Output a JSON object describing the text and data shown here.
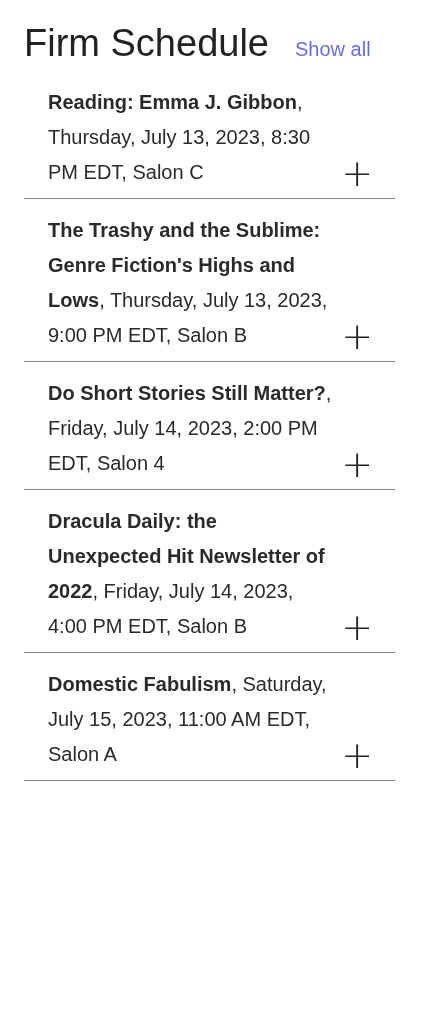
{
  "heading": "Firm Schedule",
  "show_all_link": "Show all",
  "events": [
    {
      "text": "**Reading: Emma J. Gibbon**, Thursday, July 13, 2023, 8:30 PM EDT, Salon C",
      "add_button": "+"
    },
    {
      "text": "**The Trashy and the Sublime: Genre Fiction's Highs and Lows**, Thursday, July 13, 2023, 9:00 PM EDT, Salon B",
      "add_button": "+"
    },
    {
      "text": "**Do Short Stories Still Matter?**, Friday, July 14, 2023, 2:00 PM EDT, Salon 4",
      "add_button": "+"
    },
    {
      "text": "**Dracula Daily: the Unexpected Hit Newsletter of 2022**, Friday, July 14, 2023, 4:00 PM EDT, Salon B",
      "add_button": "+"
    },
    {
      "text": "**Domestic Fabulism**, Saturday, July 15, 2023, 11:00 AM EDT, Salon A",
      "add_button": "+"
    }
  ]
}
